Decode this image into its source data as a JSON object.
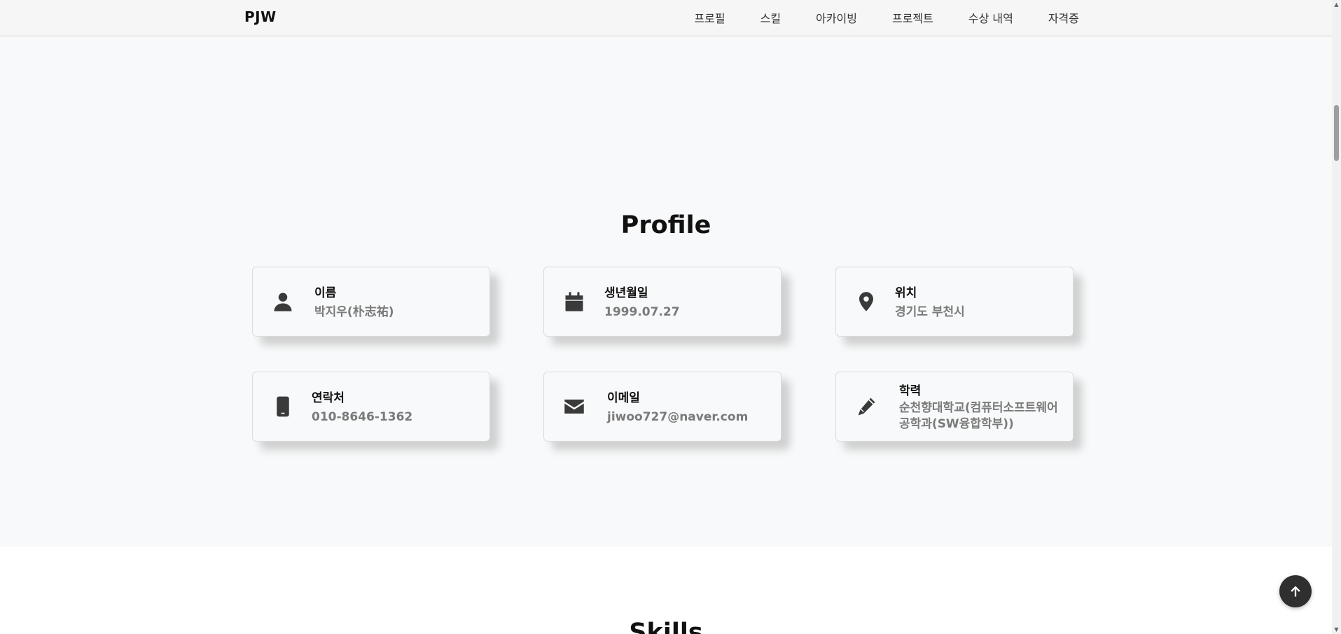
{
  "navbar": {
    "brand": "PJW",
    "items": [
      {
        "label": "프로필"
      },
      {
        "label": "스킬"
      },
      {
        "label": "아카이빙"
      },
      {
        "label": "프로젝트"
      },
      {
        "label": "수상 내역"
      },
      {
        "label": "자격증"
      }
    ]
  },
  "profile": {
    "title": "Profile",
    "cards": [
      {
        "icon": "person-icon",
        "label": "이름",
        "value": "박지우(朴志祐)"
      },
      {
        "icon": "calendar-icon",
        "label": "생년월일",
        "value": "1999.07.27"
      },
      {
        "icon": "location-pin-icon",
        "label": "위치",
        "value": "경기도 부천시"
      },
      {
        "icon": "mobile-phone-icon",
        "label": "연락처",
        "value": "010-8646-1362"
      },
      {
        "icon": "envelope-icon",
        "label": "이메일",
        "value": "jiwoo727@naver.com"
      },
      {
        "icon": "pencil-icon",
        "label": "학력",
        "value": "순천향대학교(컴퓨터소프트웨어공학과(SW융합학부))"
      }
    ]
  },
  "skills": {
    "title": "Skills"
  },
  "scroll_top": {
    "icon": "arrow-up-icon"
  },
  "colors": {
    "navbar_bg": "#f6f6f6",
    "section_bg": "#f8f9fa",
    "value_text": "#7a7a7a",
    "icon": "#3a3a3a",
    "top_button_bg": "#2f2f2f"
  }
}
